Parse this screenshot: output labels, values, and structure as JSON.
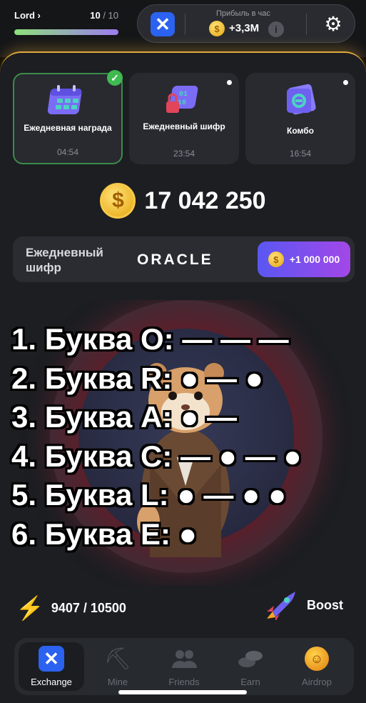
{
  "header": {
    "rank_label": "Lord",
    "level_current": "10",
    "level_total": "/ 10",
    "level_progress": 1.0,
    "profit_label": "Прибыль в час",
    "profit_value": "+3,3M"
  },
  "cards": [
    {
      "title": "Ежедневная награда",
      "time": "04:54",
      "completed": true
    },
    {
      "title": "Ежедневный шифр",
      "time": "23:54",
      "completed": false
    },
    {
      "title": "Комбо",
      "time": "16:54",
      "completed": false
    }
  ],
  "balance": "17 042 250",
  "cipher": {
    "label": "Ежедневный шифр",
    "word": "ORACLE",
    "reward": "+1 000 000"
  },
  "overlay_lines": [
    "1. Буква O: — — —",
    "2. Буква R: ● — ●",
    "3. Буква A: ● —",
    "4. Буква C: — ● — ●",
    "5. Буква L: ● — ● ●",
    "6. Буква E: ●"
  ],
  "energy": "9407 / 10500",
  "boost_label": "Boost",
  "nav": [
    {
      "label": "Exchange",
      "icon": "exchange-icon",
      "active": true
    },
    {
      "label": "Mine",
      "icon": "pickaxe-icon",
      "active": false
    },
    {
      "label": "Friends",
      "icon": "friends-icon",
      "active": false
    },
    {
      "label": "Earn",
      "icon": "coins-icon",
      "active": false
    },
    {
      "label": "Airdrop",
      "icon": "airdrop-icon",
      "active": false
    }
  ],
  "colors": {
    "accent_purple": "#5a57f2",
    "gold": "#f7c948",
    "exchange_blue": "#2b62f0",
    "check_green": "#3fb950"
  }
}
